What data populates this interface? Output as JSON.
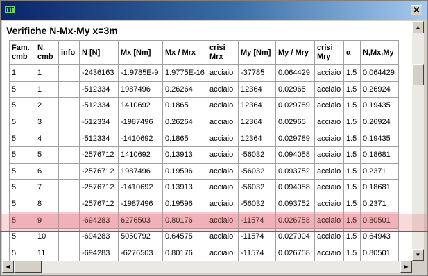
{
  "window": {
    "close_glyph": "✕",
    "app_icon": "grid-app-icon"
  },
  "heading": "Verifiche N-Mx-My x=3m",
  "table": {
    "columns": [
      "Fam. cmb",
      "N. cmb",
      "info",
      "N [N]",
      "Mx [Nm]",
      "Mx / Mrx",
      "crisi Mrx",
      "My [Nm]",
      "My / Mry",
      "crisi Mry",
      "α",
      "N,Mx,My"
    ],
    "rows": [
      [
        "1",
        "1",
        "",
        "-2436163",
        "-1.9785E-9",
        "1.9775E-16",
        "acciaio",
        "-37785",
        "0.064429",
        "acciaio",
        "1.5",
        "0.064429"
      ],
      [
        "5",
        "1",
        "",
        "-512334",
        "1987496",
        "0.26264",
        "acciaio",
        "12364",
        "0.02965",
        "acciaio",
        "1.5",
        "0.26924"
      ],
      [
        "5",
        "2",
        "",
        "-512334",
        "1410692",
        "0.1865",
        "acciaio",
        "12364",
        "0.029789",
        "acciaio",
        "1.5",
        "0.19435"
      ],
      [
        "5",
        "3",
        "",
        "-512334",
        "-1987496",
        "0.26264",
        "acciaio",
        "12364",
        "0.02965",
        "acciaio",
        "1.5",
        "0.26924"
      ],
      [
        "5",
        "4",
        "",
        "-512334",
        "-1410692",
        "0.1865",
        "acciaio",
        "12364",
        "0.029789",
        "acciaio",
        "1.5",
        "0.19435"
      ],
      [
        "5",
        "5",
        "",
        "-2576712",
        "1410692",
        "0.13913",
        "acciaio",
        "-56032",
        "0.094058",
        "acciaio",
        "1.5",
        "0.18681"
      ],
      [
        "5",
        "6",
        "",
        "-2576712",
        "1987496",
        "0.19596",
        "acciaio",
        "-56032",
        "0.093752",
        "acciaio",
        "1.5",
        "0.2371"
      ],
      [
        "5",
        "7",
        "",
        "-2576712",
        "-1410692",
        "0.13913",
        "acciaio",
        "-56032",
        "0.094058",
        "acciaio",
        "1.5",
        "0.18681"
      ],
      [
        "5",
        "8",
        "",
        "-2576712",
        "-1987496",
        "0.19596",
        "acciaio",
        "-56032",
        "0.093752",
        "acciaio",
        "1.5",
        "0.2371"
      ],
      [
        "5",
        "9",
        "",
        "-694283",
        "6276503",
        "0.80176",
        "acciaio",
        "-11574",
        "0.026758",
        "acciaio",
        "1.5",
        "0.80501"
      ],
      [
        "5",
        "10",
        "",
        "-694283",
        "5050792",
        "0.64575",
        "acciaio",
        "-11574",
        "0.027004",
        "acciaio",
        "1.5",
        "0.64943"
      ],
      [
        "5",
        "11",
        "",
        "-694283",
        "-6276503",
        "0.80176",
        "acciaio",
        "-11574",
        "0.026758",
        "acciaio",
        "1.5",
        "0.80501"
      ]
    ],
    "highlighted_row": 9,
    "highlight_color": "#f4c8cc"
  },
  "scrollbars": {
    "up": "▲",
    "down": "▼",
    "left": "◀",
    "right": "▶"
  }
}
